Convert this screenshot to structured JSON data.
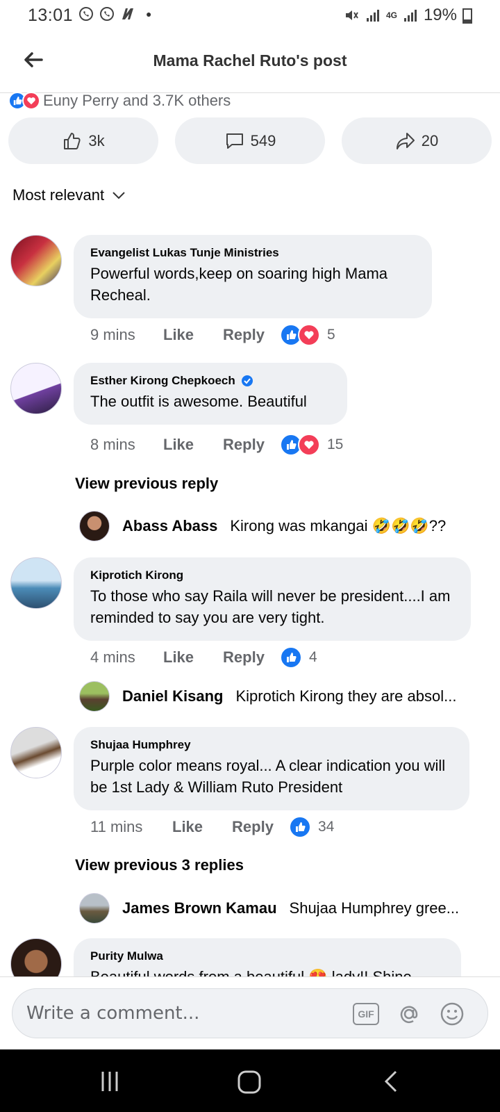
{
  "status_bar": {
    "time": "13:01",
    "battery": "19%",
    "network": "4G"
  },
  "header": {
    "title": "Mama Rachel Ruto's post"
  },
  "reactions_summary": "Euny Perry and 3.7K others",
  "actions": {
    "likes": "3k",
    "comments": "549",
    "shares": "20"
  },
  "sort_label": "Most relevant",
  "comments": [
    {
      "name": "Evangelist  Lukas Tunje Ministries",
      "text": "Powerful words,keep on soaring high Mama Recheal.",
      "time": "9 mins",
      "like": "Like",
      "reply": "Reply",
      "reaction_count": "5"
    },
    {
      "name": "Esther Kirong Chepkoech",
      "text": "The outfit is awesome. Beautiful",
      "time": "8 mins",
      "like": "Like",
      "reply": "Reply",
      "reaction_count": "15"
    },
    {
      "name": "Kiprotich Kirong",
      "text": "To those who say Raila will never be president....I am reminded to  say you are very tight.",
      "time": "4 mins",
      "like": "Like",
      "reply": "Reply",
      "reaction_count": "4"
    },
    {
      "name": "Shujaa Humphrey",
      "text": "Purple color means royal... A clear indication you will be 1st Lady & William Ruto President",
      "time": "11 mins",
      "like": "Like",
      "reply": "Reply",
      "reaction_count": "34"
    },
    {
      "name": "Purity Mulwa",
      "text": "Beautiful words from a beautiful 😍 lady!! Shine"
    }
  ],
  "view_previous": [
    "View previous reply",
    "View previous 3 replies"
  ],
  "replies": [
    {
      "name": "Abass Abass",
      "text": "Kirong was mkangai 🤣🤣🤣??"
    },
    {
      "name": "Daniel Kisang",
      "text": "Kiprotich Kirong they are absol..."
    },
    {
      "name": "James Brown Kamau",
      "text": "Shujaa Humphrey gree..."
    }
  ],
  "composer": {
    "placeholder": "Write a comment...",
    "gif": "GIF"
  },
  "colors": {
    "like": "#1877f2",
    "love": "#f33e58",
    "verified": "#1877f2"
  }
}
